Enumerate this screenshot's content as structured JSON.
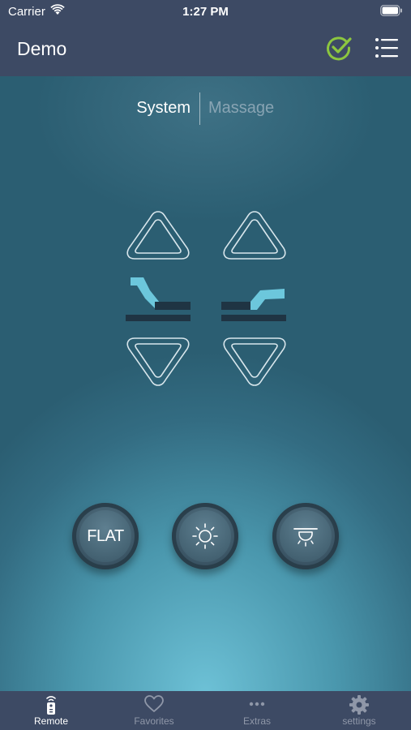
{
  "status_bar": {
    "carrier": "Carrier",
    "time": "1:27 PM"
  },
  "nav": {
    "title": "Demo",
    "check_icon": "check-circle-icon",
    "list_icon": "list-icon",
    "check_color": "#8cc63f"
  },
  "segments": {
    "system": "System",
    "massage": "Massage",
    "selected": "System"
  },
  "controls": {
    "head_up": "triangle-up-icon",
    "foot_up": "triangle-up-icon",
    "head_down": "triangle-down-icon",
    "foot_down": "triangle-down-icon",
    "head_indicator": "bed-head-icon",
    "foot_indicator": "bed-foot-icon",
    "accent": "#6cc7dc"
  },
  "buttons": {
    "flat_label": "FLAT",
    "light_icon": "sun-icon",
    "underbed_light_icon": "underbed-light-icon"
  },
  "tabs": [
    {
      "label": "Remote",
      "icon": "remote-icon",
      "active": true
    },
    {
      "label": "Favorites",
      "icon": "heart-icon",
      "active": false
    },
    {
      "label": "Extras",
      "icon": "ellipsis-icon",
      "active": false
    },
    {
      "label": "settings",
      "icon": "gear-icon",
      "active": false
    }
  ]
}
